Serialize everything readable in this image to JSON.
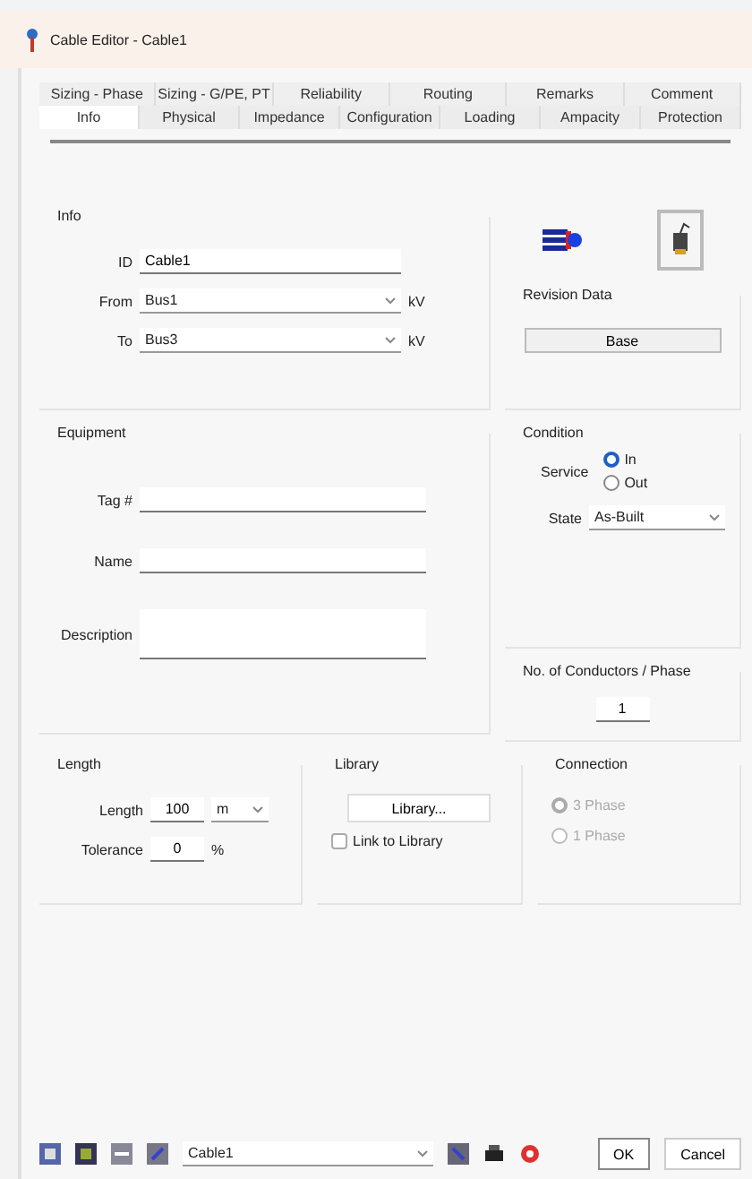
{
  "window": {
    "title": "Cable Editor - Cable1"
  },
  "tabs_back": [
    {
      "label": "Sizing - Phase",
      "selected": false
    },
    {
      "label": "Sizing - G/PE, PT",
      "selected": false
    },
    {
      "label": "Reliability",
      "selected": false
    },
    {
      "label": "Routing",
      "selected": false
    },
    {
      "label": "Remarks",
      "selected": false
    },
    {
      "label": "Comment",
      "selected": false
    }
  ],
  "tabs_front": [
    {
      "label": "Info",
      "selected": true
    },
    {
      "label": "Physical",
      "selected": false
    },
    {
      "label": "Impedance",
      "selected": false
    },
    {
      "label": "Configuration",
      "selected": false
    },
    {
      "label": "Loading",
      "selected": false
    },
    {
      "label": "Ampacity",
      "selected": false
    },
    {
      "label": "Protection",
      "selected": false
    }
  ],
  "info": {
    "title": "Info",
    "id_label": "ID",
    "id_value": "Cable1",
    "from_label": "From",
    "from_value": "Bus1",
    "from_unit": "kV",
    "to_label": "To",
    "to_value": "Bus3",
    "to_unit": "kV"
  },
  "revision": {
    "title": "Revision Data",
    "button": "Base"
  },
  "equipment": {
    "title": "Equipment",
    "tag_label": "Tag #",
    "name_label": "Name",
    "description_label": "Description"
  },
  "condition": {
    "title": "Condition",
    "service_label": "Service",
    "options": [
      {
        "label": "In",
        "selected": true
      },
      {
        "label": "Out",
        "selected": false
      }
    ],
    "state_label": "State",
    "state_value": "As-Built"
  },
  "conductors": {
    "title": "No. of Conductors / Phase",
    "value": "1"
  },
  "length": {
    "title": "Length",
    "length_label": "Length",
    "length_value": "100",
    "unit": "m",
    "tolerance_label": "Tolerance",
    "tolerance_value": "0",
    "tolerance_unit": "%"
  },
  "library": {
    "title": "Library",
    "button": "Library...",
    "link_label": "Link to Library",
    "checked": false
  },
  "connection": {
    "title": "Connection",
    "disabled": true,
    "options": [
      {
        "label": "3 Phase",
        "selected": true
      },
      {
        "label": "1 Phase",
        "selected": false
      }
    ]
  },
  "footer": {
    "cable_select": "Cable1",
    "ok": "OK",
    "cancel": "Cancel"
  }
}
